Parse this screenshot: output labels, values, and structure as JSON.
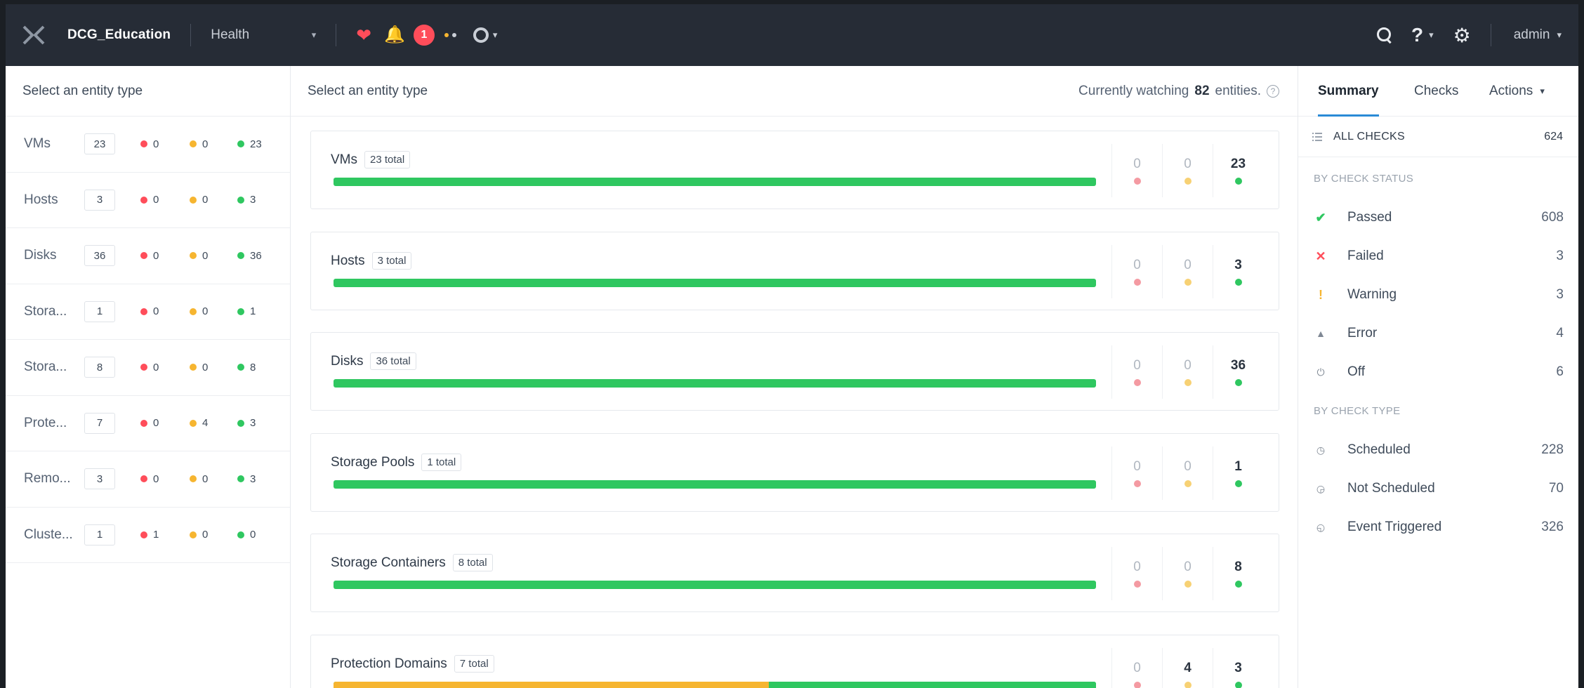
{
  "topbar": {
    "cluster_name": "DCG_Education",
    "view": "Health",
    "alert_count": "1",
    "user": "admin"
  },
  "left_panel": {
    "heading": "Select an entity type",
    "entities": [
      {
        "name": "VMs",
        "count": "23",
        "red": "0",
        "amber": "0",
        "green": "23"
      },
      {
        "name": "Hosts",
        "count": "3",
        "red": "0",
        "amber": "0",
        "green": "3"
      },
      {
        "name": "Disks",
        "count": "36",
        "red": "0",
        "amber": "0",
        "green": "36"
      },
      {
        "name": "Stora...",
        "count": "1",
        "red": "0",
        "amber": "0",
        "green": "1"
      },
      {
        "name": "Stora...",
        "count": "8",
        "red": "0",
        "amber": "0",
        "green": "8"
      },
      {
        "name": "Prote...",
        "count": "7",
        "red": "0",
        "amber": "4",
        "green": "3"
      },
      {
        "name": "Remo...",
        "count": "3",
        "red": "0",
        "amber": "0",
        "green": "3"
      },
      {
        "name": "Cluste...",
        "count": "1",
        "red": "1",
        "amber": "0",
        "green": "0"
      }
    ]
  },
  "middle_panel": {
    "heading": "Select an entity type",
    "watching_prefix": "Currently watching",
    "watching_count": "82",
    "watching_suffix": "entities.",
    "cards": [
      {
        "name": "VMs",
        "total": "23 total",
        "red": "0",
        "amber": "0",
        "green": "23",
        "amber_fraction": 0
      },
      {
        "name": "Hosts",
        "total": "3 total",
        "red": "0",
        "amber": "0",
        "green": "3",
        "amber_fraction": 0
      },
      {
        "name": "Disks",
        "total": "36 total",
        "red": "0",
        "amber": "0",
        "green": "36",
        "amber_fraction": 0
      },
      {
        "name": "Storage Pools",
        "total": "1 total",
        "red": "0",
        "amber": "0",
        "green": "1",
        "amber_fraction": 0
      },
      {
        "name": "Storage Containers",
        "total": "8 total",
        "red": "0",
        "amber": "0",
        "green": "8",
        "amber_fraction": 0
      },
      {
        "name": "Protection Domains",
        "total": "7 total",
        "red": "0",
        "amber": "4",
        "green": "3",
        "amber_fraction": 0.571
      }
    ]
  },
  "right_panel": {
    "tabs": {
      "summary": "Summary",
      "checks": "Checks",
      "actions": "Actions"
    },
    "all_checks_label": "ALL CHECKS",
    "all_checks_value": "624",
    "by_status_label": "BY CHECK STATUS",
    "status_rows": [
      {
        "label": "Passed",
        "value": "608",
        "icon": "check-icon"
      },
      {
        "label": "Failed",
        "value": "3",
        "icon": "x-icon"
      },
      {
        "label": "Warning",
        "value": "3",
        "icon": "exclamation-icon"
      },
      {
        "label": "Error",
        "value": "4",
        "icon": "error-icon"
      },
      {
        "label": "Off",
        "value": "6",
        "icon": "power-icon"
      }
    ],
    "by_type_label": "BY CHECK TYPE",
    "type_rows": [
      {
        "label": "Scheduled",
        "value": "228",
        "icon": "clock-icon"
      },
      {
        "label": "Not Scheduled",
        "value": "70",
        "icon": "clock-off-icon"
      },
      {
        "label": "Event Triggered",
        "value": "326",
        "icon": "clock-event-icon"
      }
    ]
  },
  "colors": {
    "topbar": "#262c36",
    "critical": "#ff4d5a",
    "warning": "#f6b530",
    "good": "#2fc760",
    "accent": "#2a8bd6"
  }
}
